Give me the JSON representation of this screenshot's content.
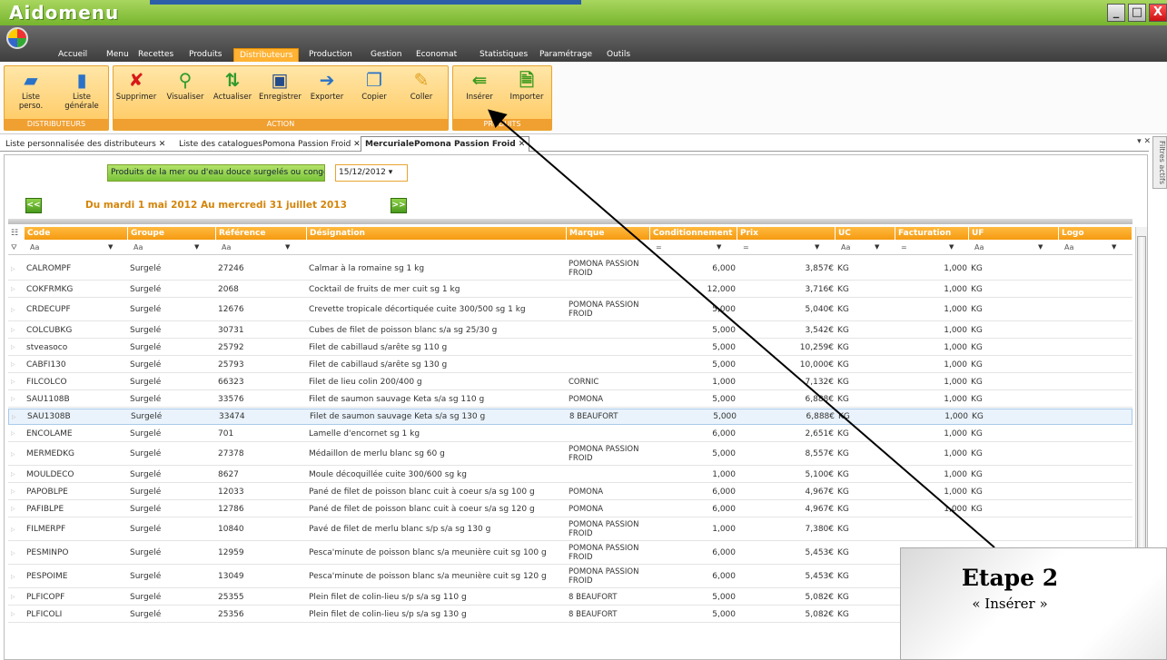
{
  "app": {
    "title": "Aidomenu"
  },
  "window_controls": {
    "minimize": "_",
    "maximize": "□",
    "close": "X"
  },
  "menu": [
    "Accueil",
    "Menu",
    "Recettes",
    "Produits",
    "Distributeurs",
    "Production",
    "Gestion",
    "Economat",
    "Statistiques",
    "Paramétrage",
    "Outils"
  ],
  "menu_active": "Distributeurs",
  "ribbon": {
    "distributeurs": {
      "title": "DISTRIBUTEURS",
      "buttons": [
        "Liste perso.",
        "Liste générale"
      ]
    },
    "action": {
      "title": "ACTION",
      "buttons": [
        "Supprimer",
        "Visualiser",
        "Actualiser",
        "Enregistrer",
        "Exporter",
        "Copier",
        "Coller"
      ]
    },
    "produits": {
      "title": "PRODUITS",
      "buttons": [
        "Insérer",
        "Importer"
      ]
    }
  },
  "tabs": [
    "Liste personnalisée des distributeurs",
    "Liste des cataloguesPomona Passion Froid",
    "MercurialePomona Passion Froid"
  ],
  "side_panel": "Filtres actifs",
  "filters": {
    "category": "Produits de la mer ou d'eau douce surgelés ou congelés",
    "date": "15/12/2012",
    "prev": "<<",
    "next": ">>",
    "period": "Du mardi 1 mai 2012 Au mercredi 31 juillet 2013"
  },
  "columns": [
    "Code",
    "Groupe",
    "Référence",
    "Désignation",
    "Marque",
    "Conditionnement",
    "Prix",
    "UC",
    "Facturation",
    "UF",
    "Logo"
  ],
  "filter_placeholder": "Aa",
  "filter_equal": "=",
  "rows": [
    {
      "code": "CALROMPF",
      "groupe": "Surgelé",
      "ref": "27246",
      "desig": "Calmar à la romaine sg 1 kg",
      "marque": "POMONA PASSION FROID",
      "cond": "6,000",
      "prix": "3,857€",
      "uc": "KG",
      "fact": "1,000",
      "uf": "KG"
    },
    {
      "code": "COKFRMKG",
      "groupe": "Surgelé",
      "ref": "2068",
      "desig": "Cocktail de fruits de mer cuit sg 1 kg",
      "marque": "",
      "cond": "12,000",
      "prix": "3,716€",
      "uc": "KG",
      "fact": "1,000",
      "uf": "KG"
    },
    {
      "code": "CRDECUPF",
      "groupe": "Surgelé",
      "ref": "12676",
      "desig": "Crevette tropicale décortiquée cuite 300/500 sg 1 kg",
      "marque": "POMONA PASSION FROID",
      "cond": "5,000",
      "prix": "5,040€",
      "uc": "KG",
      "fact": "1,000",
      "uf": "KG"
    },
    {
      "code": "COLCUBKG",
      "groupe": "Surgelé",
      "ref": "30731",
      "desig": "Cubes de filet de poisson blanc s/a sg 25/30 g",
      "marque": "",
      "cond": "5,000",
      "prix": "3,542€",
      "uc": "KG",
      "fact": "1,000",
      "uf": "KG"
    },
    {
      "code": "stveasoco",
      "groupe": "Surgelé",
      "ref": "25792",
      "desig": "Filet de cabillaud s/arête sg 110 g",
      "marque": "",
      "cond": "5,000",
      "prix": "10,259€",
      "uc": "KG",
      "fact": "1,000",
      "uf": "KG"
    },
    {
      "code": "CABFI130",
      "groupe": "Surgelé",
      "ref": "25793",
      "desig": "Filet de cabillaud s/arête sg 130 g",
      "marque": "",
      "cond": "5,000",
      "prix": "10,000€",
      "uc": "KG",
      "fact": "1,000",
      "uf": "KG"
    },
    {
      "code": "FILCOLCO",
      "groupe": "Surgelé",
      "ref": "66323",
      "desig": "Filet de lieu colin 200/400 g",
      "marque": "CORNIC",
      "cond": "1,000",
      "prix": "7,132€",
      "uc": "KG",
      "fact": "1,000",
      "uf": "KG"
    },
    {
      "code": "SAU1108B",
      "groupe": "Surgelé",
      "ref": "33576",
      "desig": "Filet de saumon sauvage Keta s/a sg 110 g",
      "marque": "POMONA",
      "cond": "5,000",
      "prix": "6,888€",
      "uc": "KG",
      "fact": "1,000",
      "uf": "KG"
    },
    {
      "code": "SAU1308B",
      "groupe": "Surgelé",
      "ref": "33474",
      "desig": "Filet de saumon sauvage Keta s/a sg 130 g",
      "marque": "8 BEAUFORT",
      "cond": "5,000",
      "prix": "6,888€",
      "uc": "KG",
      "fact": "1,000",
      "uf": "KG"
    },
    {
      "code": "ENCOLAME",
      "groupe": "Surgelé",
      "ref": "701",
      "desig": "Lamelle d'encornet sg 1 kg",
      "marque": "",
      "cond": "6,000",
      "prix": "2,651€",
      "uc": "KG",
      "fact": "1,000",
      "uf": "KG"
    },
    {
      "code": "MERMEDKG",
      "groupe": "Surgelé",
      "ref": "27378",
      "desig": "Médaillon de merlu blanc sg 60 g",
      "marque": "POMONA PASSION FROID",
      "cond": "5,000",
      "prix": "8,557€",
      "uc": "KG",
      "fact": "1,000",
      "uf": "KG"
    },
    {
      "code": "MOULDECO",
      "groupe": "Surgelé",
      "ref": "8627",
      "desig": "Moule décoquillée cuite 300/600 sg kg",
      "marque": "",
      "cond": "1,000",
      "prix": "5,100€",
      "uc": "KG",
      "fact": "1,000",
      "uf": "KG"
    },
    {
      "code": "PAPOBLPE",
      "groupe": "Surgelé",
      "ref": "12033",
      "desig": "Pané de filet de poisson blanc cuit à coeur s/a sg 100 g",
      "marque": "POMONA",
      "cond": "6,000",
      "prix": "4,967€",
      "uc": "KG",
      "fact": "1,000",
      "uf": "KG"
    },
    {
      "code": "PAFIBLPE",
      "groupe": "Surgelé",
      "ref": "12786",
      "desig": "Pané de filet de poisson blanc cuit à coeur s/a sg 120 g",
      "marque": "POMONA",
      "cond": "6,000",
      "prix": "4,967€",
      "uc": "KG",
      "fact": "1,000",
      "uf": "KG"
    },
    {
      "code": "FILMERPF",
      "groupe": "Surgelé",
      "ref": "10840",
      "desig": "Pavé de filet de merlu blanc s/p s/a sg 130 g",
      "marque": "POMONA PASSION FROID",
      "cond": "1,000",
      "prix": "7,380€",
      "uc": "KG",
      "fact": "",
      "uf": ""
    },
    {
      "code": "PESMINPO",
      "groupe": "Surgelé",
      "ref": "12959",
      "desig": "Pesca'minute de poisson blanc s/a meunière cuit sg 100 g",
      "marque": "POMONA PASSION FROID",
      "cond": "6,000",
      "prix": "5,453€",
      "uc": "KG",
      "fact": "",
      "uf": ""
    },
    {
      "code": "PESPOIME",
      "groupe": "Surgelé",
      "ref": "13049",
      "desig": "Pesca'minute de poisson blanc s/a meunière cuit sg 120 g",
      "marque": "POMONA PASSION FROID",
      "cond": "6,000",
      "prix": "5,453€",
      "uc": "KG",
      "fact": "",
      "uf": ""
    },
    {
      "code": "PLFICOPF",
      "groupe": "Surgelé",
      "ref": "25355",
      "desig": "Plein filet de colin-lieu s/p s/a sg 110 g",
      "marque": "8 BEAUFORT",
      "cond": "5,000",
      "prix": "5,082€",
      "uc": "KG",
      "fact": "",
      "uf": ""
    },
    {
      "code": "PLFICOLI",
      "groupe": "Surgelé",
      "ref": "25356",
      "desig": "Plein filet de colin-lieu s/p s/a sg 130 g",
      "marque": "8 BEAUFORT",
      "cond": "5,000",
      "prix": "5,082€",
      "uc": "KG",
      "fact": "",
      "uf": ""
    }
  ],
  "callout": {
    "title": "Etape 2",
    "subtitle": "« Insérer »"
  },
  "colors": {
    "accent": "#f59a10",
    "titlebar": "#76b52e",
    "menubar": "#3e3e3e"
  }
}
